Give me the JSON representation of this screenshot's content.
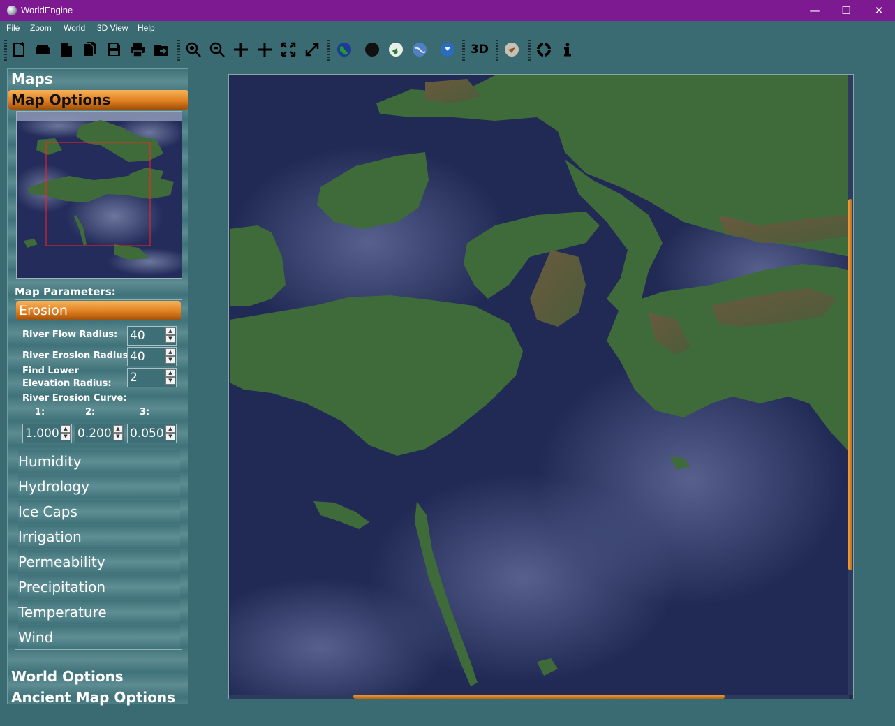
{
  "window": {
    "title": "WorldEngine",
    "minimize": "—",
    "maximize": "☐",
    "close": "✕"
  },
  "menu": [
    "File",
    "Zoom",
    "World",
    "3D View",
    "Help"
  ],
  "toolbar": {
    "3d_label": "3D"
  },
  "panel": {
    "maps": "Maps",
    "map_options": "Map Options",
    "map_parameters": "Map Parameters:",
    "erosion": "Erosion",
    "river_flow_radius_label": "River Flow Radius:",
    "river_flow_radius": "40",
    "river_erosion_radius_label": "River Erosion Radius:",
    "river_erosion_radius": "40",
    "find_lower_label": "Find Lower Elevation Radius:",
    "find_lower": "2",
    "river_erosion_curve_label": "River Erosion Curve:",
    "curve_1_label": "1:",
    "curve_2_label": "2:",
    "curve_3_label": "3:",
    "curve_1": "1.000",
    "curve_2": "0.200",
    "curve_3": "0.050",
    "categories": [
      "Humidity",
      "Hydrology",
      "Ice Caps",
      "Irrigation",
      "Permeability",
      "Precipitation",
      "Temperature",
      "Wind"
    ],
    "world_options": "World Options",
    "ancient_map_options": "Ancient Map Options"
  },
  "colors": {
    "titlebar": "#7d1a91",
    "accent": "#e07f20",
    "panel": "#3a6a72",
    "ocean": "#202a55",
    "land": "#3f6b3a"
  },
  "scroll": {
    "vertical_fraction": 0.6,
    "horizontal_fraction": 0.6
  }
}
